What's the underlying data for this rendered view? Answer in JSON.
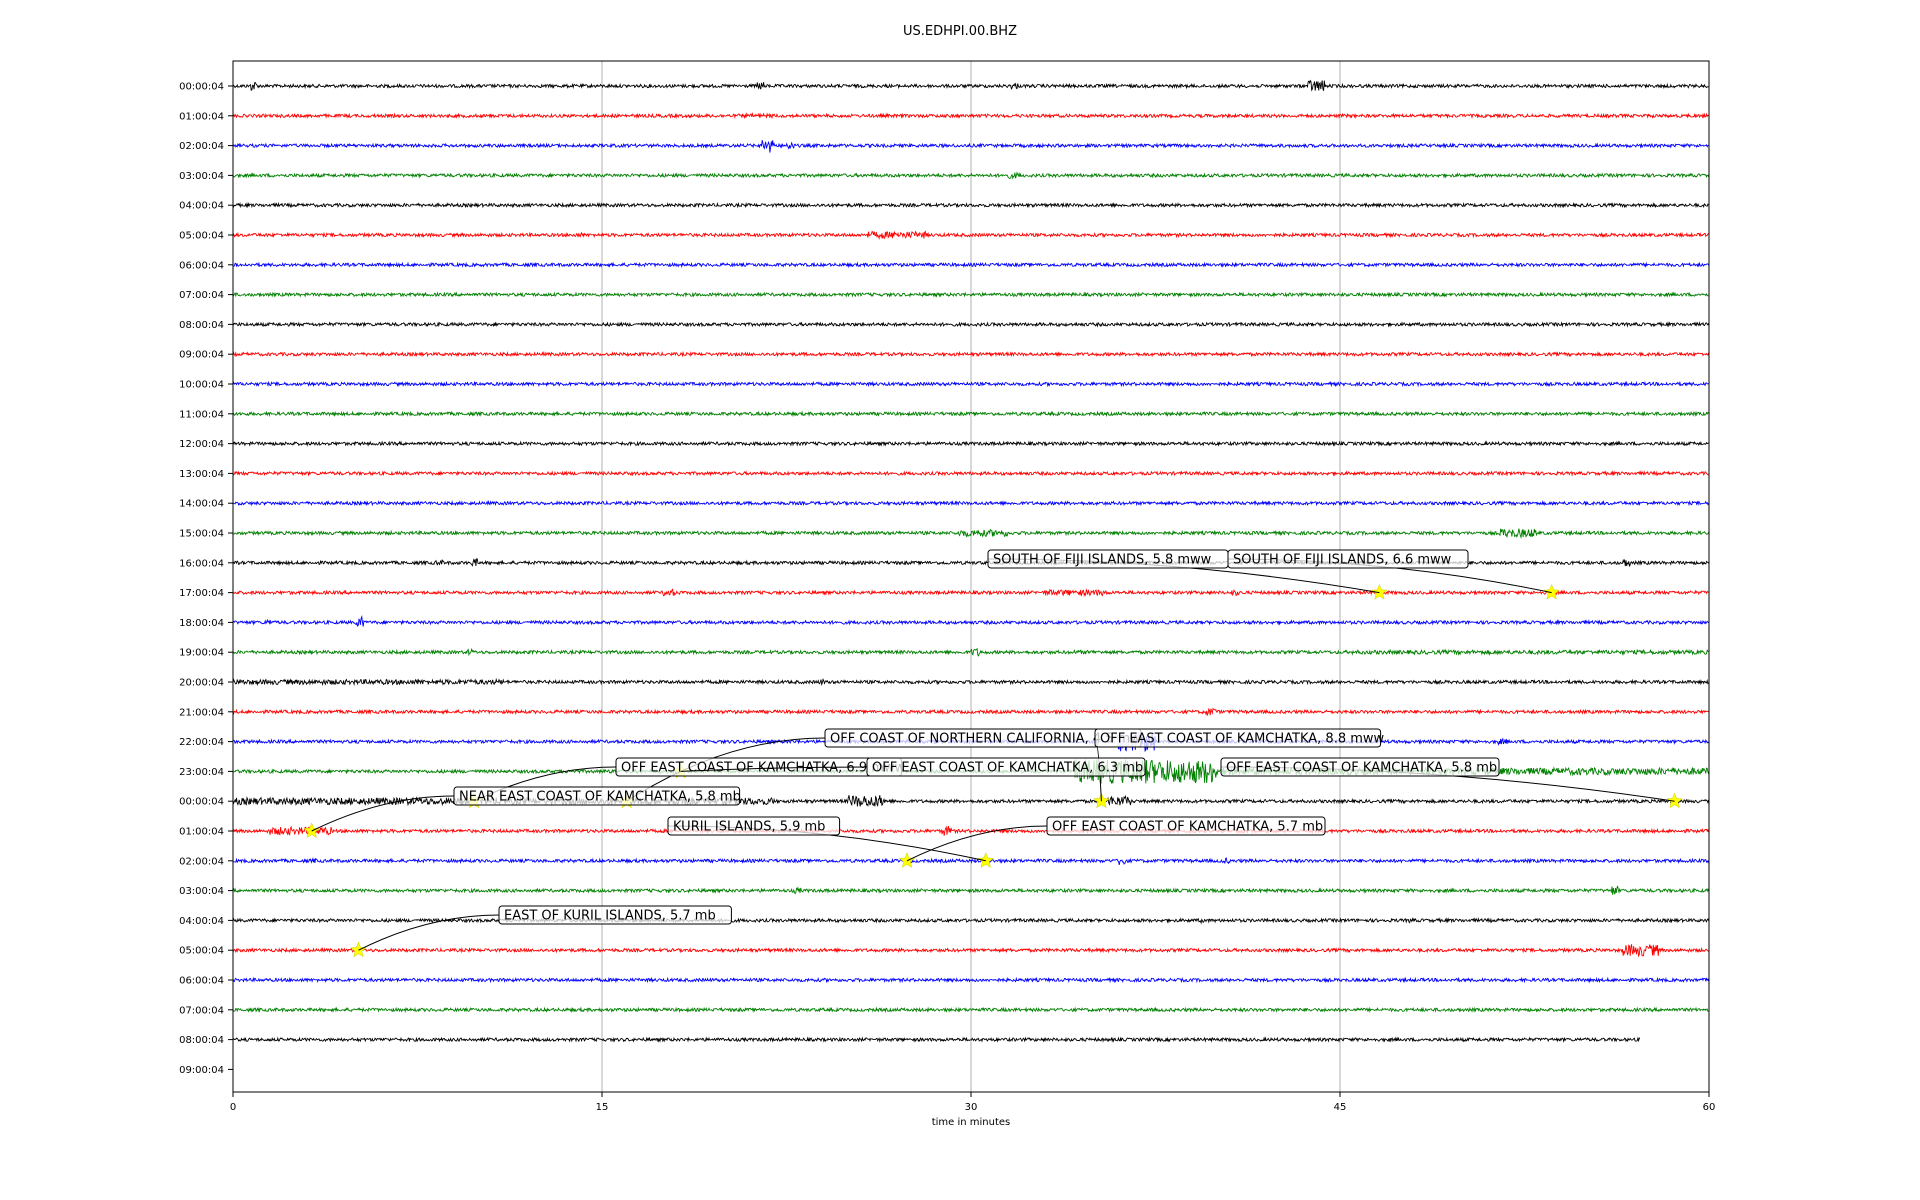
{
  "chart_data": {
    "type": "line",
    "title": "US.EDHPI.00.BHZ",
    "xlabel": "time in minutes",
    "ylabel": "",
    "xlim": [
      0,
      60
    ],
    "x_ticks": [
      "0",
      "15",
      "30",
      "45",
      "60"
    ],
    "grid": "vertical lines at 15, 30, 45",
    "row_labels": [
      "00:00:04",
      "01:00:04",
      "02:00:04",
      "03:00:04",
      "04:00:04",
      "05:00:04",
      "06:00:04",
      "07:00:04",
      "08:00:04",
      "09:00:04",
      "10:00:04",
      "11:00:04",
      "12:00:04",
      "13:00:04",
      "14:00:04",
      "15:00:04",
      "16:00:04",
      "17:00:04",
      "18:00:04",
      "19:00:04",
      "20:00:04",
      "21:00:04",
      "22:00:04",
      "23:00:04",
      "00:00:04",
      "01:00:04",
      "02:00:04",
      "03:00:04",
      "04:00:04",
      "05:00:04",
      "06:00:04",
      "07:00:04",
      "08:00:04",
      "09:00:04"
    ],
    "trace_colors": [
      "#000000",
      "#ff0000",
      "#0000ff",
      "#008000"
    ],
    "trace_count": 33,
    "last_trace_end_minute": 57.2,
    "events": [
      {
        "label": "SOUTH OF FIJI ISLANDS, 5.8 mww",
        "row": 17,
        "minute": 46.6
      },
      {
        "label": "SOUTH OF FIJI ISLANDS, 6.6 mww",
        "row": 17,
        "minute": 53.6
      },
      {
        "label": "OFF COAST OF NORTHERN CALIFORNIA, 4.5 mw",
        "row": 24,
        "minute": 16.0
      },
      {
        "label": "OFF EAST COAST OF KAMCHATKA, 8.8 mww",
        "row": 24,
        "minute": 35.3
      },
      {
        "label": "OFF EAST COAST OF KAMCHATKA, 6.9 mww",
        "row": 24,
        "minute": 9.8
      },
      {
        "label": "OFF EAST COAST OF KAMCHATKA, 6.3 mb",
        "row": 23,
        "minute": 18.2
      },
      {
        "label": "OFF EAST COAST OF KAMCHATKA, 5.8 mb",
        "row": 24,
        "minute": 58.6
      },
      {
        "label": "NEAR EAST COAST OF KAMCHATKA, 5.8 mb",
        "row": 25,
        "minute": 3.2
      },
      {
        "label": "KURIL ISLANDS, 5.9 mb",
        "row": 26,
        "minute": 30.6
      },
      {
        "label": "OFF EAST COAST OF KAMCHATKA, 5.7 mb",
        "row": 26,
        "minute": 27.4
      },
      {
        "label": "EAST OF KURIL ISLANDS, 5.7 mb",
        "row": 29,
        "minute": 5.1
      }
    ],
    "marker_color": "#ffff00"
  }
}
